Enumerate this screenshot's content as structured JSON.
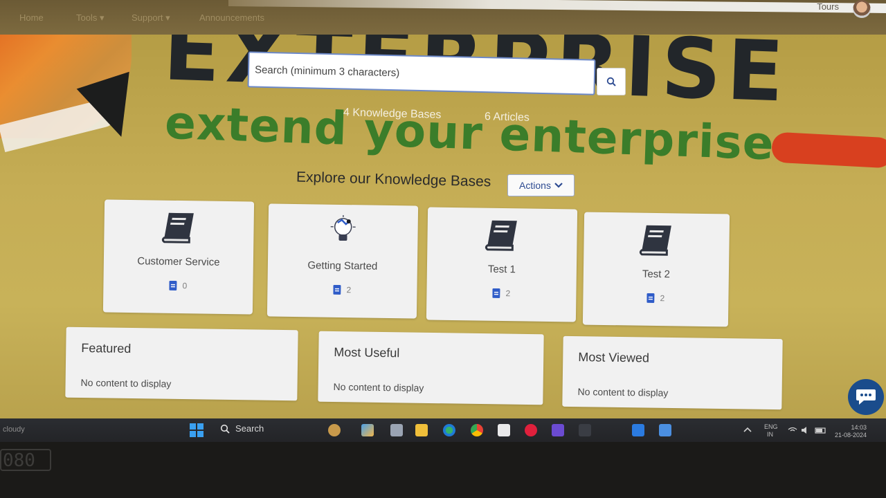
{
  "nav": {
    "items": [
      "Home",
      "Tools ▾",
      "Support ▾",
      "Announcements"
    ],
    "tours": "Tours"
  },
  "hero": {
    "brand_word": "EXTERPRISE",
    "tagline": "extend your enterprise"
  },
  "search": {
    "placeholder": "Search (minimum 3 characters)"
  },
  "stats": {
    "knowledge_bases": "4 Knowledge Bases",
    "articles": "6 Articles"
  },
  "explore": {
    "title": "Explore our Knowledge Bases",
    "actions_label": "Actions"
  },
  "knowledge_bases": [
    {
      "name": "Customer Service",
      "count": "0",
      "icon": "book-icon"
    },
    {
      "name": "Getting Started",
      "count": "2",
      "icon": "lightbulb-icon"
    },
    {
      "name": "Test 1",
      "count": "2",
      "icon": "book-icon"
    },
    {
      "name": "Test 2",
      "count": "2",
      "icon": "book-icon"
    }
  ],
  "panels": [
    {
      "title": "Featured",
      "empty": "No content to display"
    },
    {
      "title": "Most Useful",
      "empty": "No content to display"
    },
    {
      "title": "Most Viewed",
      "empty": "No content to display"
    }
  ],
  "taskbar": {
    "weather": "cloudy",
    "search_label": "Search",
    "lang_top": "ENG",
    "lang_bottom": "IN",
    "time": "14:03",
    "date": "21-08-2024"
  },
  "bezel_text": "080",
  "colors": {
    "accent": "#2c4a91",
    "hero_yellow": "#c5ad55",
    "tagline_green": "#3b7d2a",
    "chat_blue": "#1a4c8c"
  }
}
